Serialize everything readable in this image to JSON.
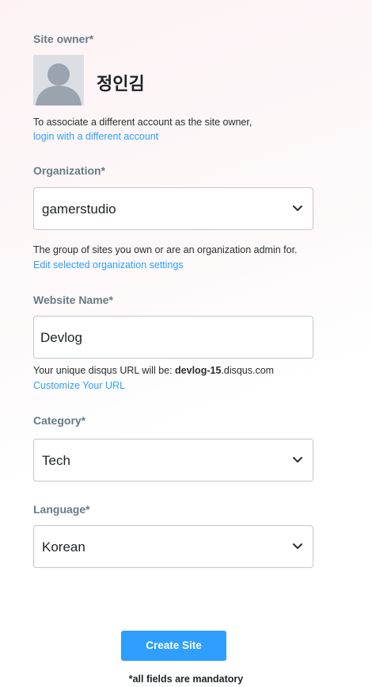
{
  "owner": {
    "label": "Site owner*",
    "name": "정인김",
    "help": "To associate a different account as the site owner,",
    "link": "login with a different account"
  },
  "organization": {
    "label": "Organization*",
    "value": "gamerstudio",
    "help": "The group of sites you own or are an organization admin for.",
    "link": "Edit selected organization settings"
  },
  "website": {
    "label": "Website Name*",
    "value": "Devlog",
    "url_prefix": "Your unique disqus URL will be: ",
    "url_sub": "devlog-15",
    "url_suffix": ".disqus.com",
    "link": "Customize Your URL"
  },
  "category": {
    "label": "Category*",
    "value": "Tech"
  },
  "language": {
    "label": "Language*",
    "value": "Korean"
  },
  "submit": {
    "label": "Create Site"
  },
  "footer": {
    "note": "*all fields are mandatory"
  },
  "icons": {
    "avatar": "user-avatar-placeholder",
    "dropdown": "chevron-down-icon"
  },
  "colors": {
    "accent": "#2e9fff",
    "label": "#687a86",
    "border": "#c2c6cc"
  }
}
